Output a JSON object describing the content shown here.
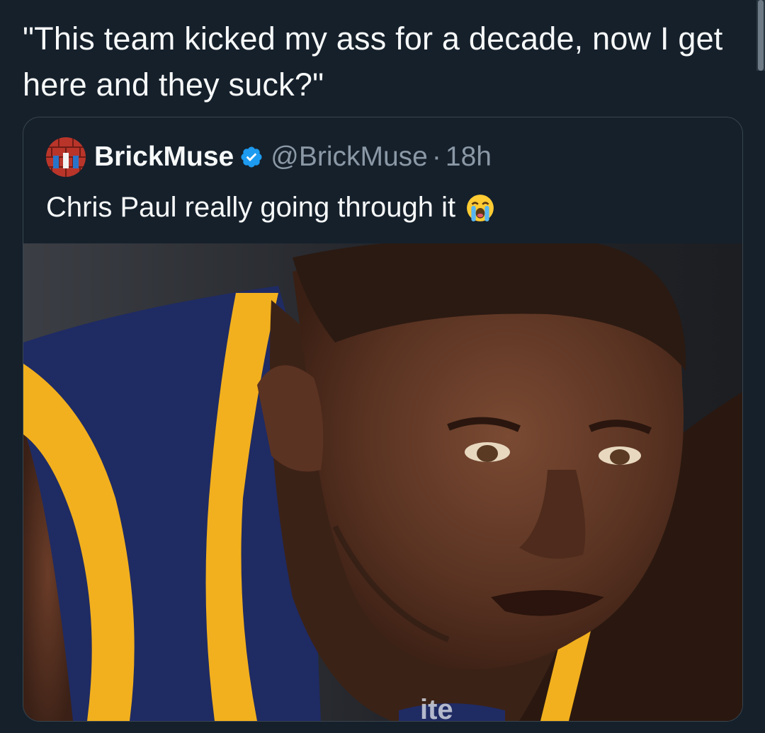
{
  "tweet": {
    "text": "\"This team kicked my ass for a decade, now I get here and they suck?\""
  },
  "quoted_tweet": {
    "display_name": "BrickMuse",
    "handle": "@BrickMuse",
    "separator": "·",
    "time": "18h",
    "text": "Chris Paul really going through it",
    "verified": true,
    "avatar_icon": "brick-wall-avatar-icon",
    "emoji_icon": "loudly-crying-face-icon",
    "media_description_icon": "basketball-player-photo"
  },
  "colors": {
    "background": "#15202b",
    "border": "#38444d",
    "text_primary": "#f7f9f9",
    "text_secondary": "#8b98a5",
    "verified_blue": "#1d9bf0"
  }
}
